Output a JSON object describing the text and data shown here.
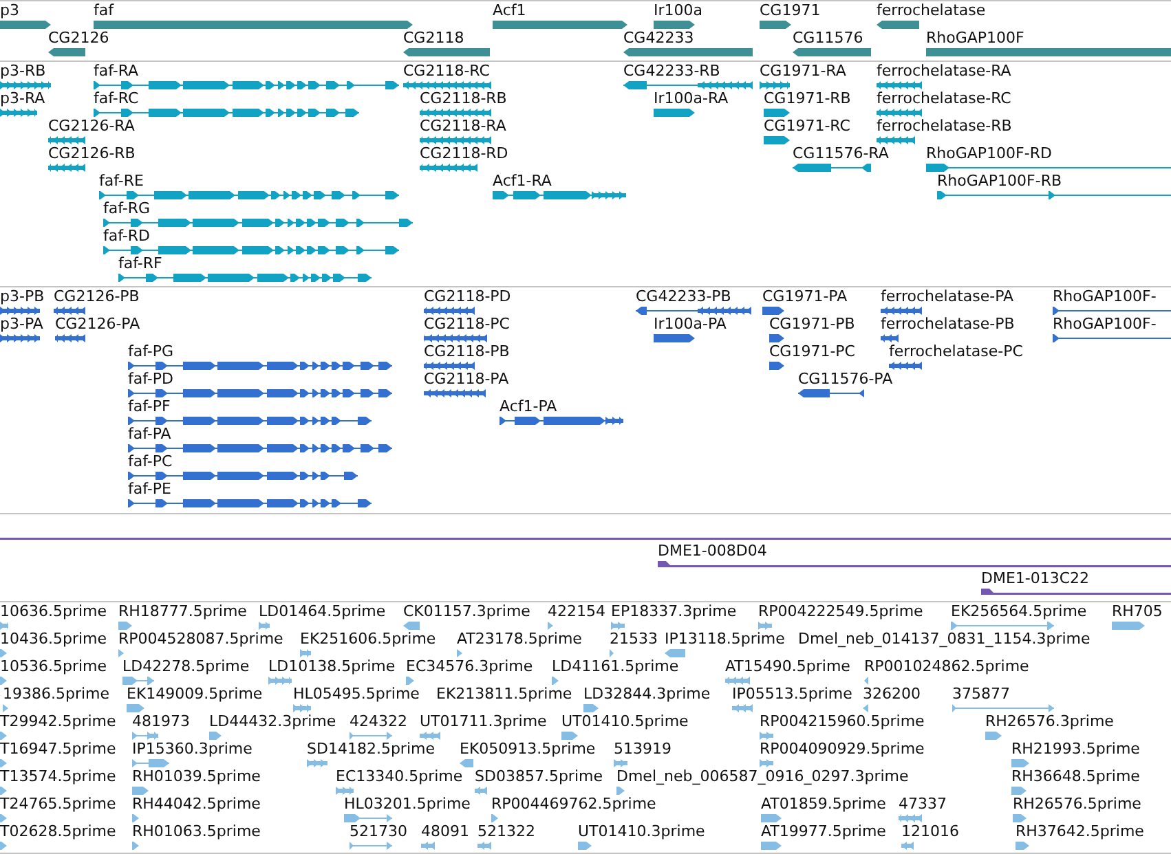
{
  "tracks": [
    {
      "kind": "gene",
      "rows": [
        {
          "features": [
            {
              "label": "p3",
              "reverse": false
            },
            {
              "label": "faf",
              "reverse": false
            },
            {
              "label": "Acf1",
              "reverse": false
            },
            {
              "label": "Ir100a",
              "reverse": false
            },
            {
              "label": "CG1971",
              "reverse": false
            },
            {
              "label": "ferrochelatase",
              "reverse": true
            }
          ]
        },
        {
          "features": [
            {
              "label": "CG2126",
              "reverse": true
            },
            {
              "label": "CG2118",
              "reverse": true
            },
            {
              "label": "CG42233",
              "reverse": true
            },
            {
              "label": "CG11576",
              "reverse": true
            },
            {
              "label": "RhoGAP100F",
              "reverse": false
            }
          ]
        }
      ]
    },
    {
      "kind": "mrna",
      "rows": [
        {
          "features": [
            {
              "label": "p3-RB",
              "reverse": false
            },
            {
              "label": "faf-RA",
              "reverse": false
            },
            {
              "label": "CG2118-RC",
              "reverse": true
            },
            {
              "label": "CG42233-RB",
              "reverse": true
            },
            {
              "label": "CG1971-RA",
              "reverse": false
            },
            {
              "label": "ferrochelatase-RA",
              "reverse": true
            }
          ]
        },
        {
          "features": [
            {
              "label": "p3-RA",
              "reverse": false
            },
            {
              "label": "faf-RC",
              "reverse": false
            },
            {
              "label": "CG2118-RB",
              "reverse": true
            },
            {
              "label": "Ir100a-RA",
              "reverse": false
            },
            {
              "label": "CG1971-RB",
              "reverse": false
            },
            {
              "label": "ferrochelatase-RC",
              "reverse": true
            }
          ]
        },
        {
          "features": [
            {
              "label": "CG2126-RA",
              "reverse": true
            },
            {
              "label": "CG2118-RA",
              "reverse": true
            },
            {
              "label": "CG1971-RC",
              "reverse": false
            },
            {
              "label": "ferrochelatase-RB",
              "reverse": true
            }
          ]
        },
        {
          "features": [
            {
              "label": "CG2126-RB",
              "reverse": true
            },
            {
              "label": "CG2118-RD",
              "reverse": true
            },
            {
              "label": "CG11576-RA",
              "reverse": true
            },
            {
              "label": "RhoGAP100F-RD",
              "reverse": false
            }
          ]
        },
        {
          "features": [
            {
              "label": "faf-RE",
              "reverse": false
            },
            {
              "label": "Acf1-RA",
              "reverse": false
            },
            {
              "label": "RhoGAP100F-RB",
              "reverse": false
            }
          ]
        },
        {
          "features": [
            {
              "label": "faf-RG",
              "reverse": false
            }
          ]
        },
        {
          "features": [
            {
              "label": "faf-RD",
              "reverse": false
            }
          ]
        },
        {
          "features": [
            {
              "label": "faf-RF",
              "reverse": false
            }
          ]
        }
      ]
    },
    {
      "kind": "protein",
      "rows": [
        {
          "features": [
            {
              "label": "p3-PB",
              "reverse": false
            },
            {
              "label": "CG2126-PB",
              "reverse": true
            },
            {
              "label": "CG2118-PD",
              "reverse": true
            },
            {
              "label": "CG42233-PB",
              "reverse": true
            },
            {
              "label": "CG1971-PA",
              "reverse": false
            },
            {
              "label": "ferrochelatase-PA",
              "reverse": true
            },
            {
              "label": "RhoGAP100F-",
              "reverse": false
            }
          ]
        },
        {
          "features": [
            {
              "label": "p3-PA",
              "reverse": false
            },
            {
              "label": "CG2126-PA",
              "reverse": true
            },
            {
              "label": "CG2118-PC",
              "reverse": true
            },
            {
              "label": "Ir100a-PA",
              "reverse": false
            },
            {
              "label": "CG1971-PB",
              "reverse": false
            },
            {
              "label": "ferrochelatase-PB",
              "reverse": true
            },
            {
              "label": "RhoGAP100F-",
              "reverse": false
            }
          ]
        },
        {
          "features": [
            {
              "label": "faf-PG",
              "reverse": false
            },
            {
              "label": "CG2118-PB",
              "reverse": true
            },
            {
              "label": "CG1971-PC",
              "reverse": false
            },
            {
              "label": "ferrochelatase-PC",
              "reverse": true
            }
          ]
        },
        {
          "features": [
            {
              "label": "faf-PD",
              "reverse": false
            },
            {
              "label": "CG2118-PA",
              "reverse": true
            },
            {
              "label": "CG11576-PA",
              "reverse": true
            }
          ]
        },
        {
          "features": [
            {
              "label": "faf-PF",
              "reverse": false
            },
            {
              "label": "Acf1-PA",
              "reverse": false
            }
          ]
        },
        {
          "features": [
            {
              "label": "faf-PA",
              "reverse": false
            }
          ]
        },
        {
          "features": [
            {
              "label": "faf-PC",
              "reverse": false
            }
          ]
        },
        {
          "features": [
            {
              "label": "faf-PE",
              "reverse": false
            }
          ]
        }
      ]
    },
    {
      "kind": "clone",
      "rows": [
        {
          "features": [
            {
              "label": "DME1-008D04",
              "reverse": false
            }
          ]
        },
        {
          "features": [
            {
              "label": "DME1-013C22",
              "reverse": false
            }
          ]
        }
      ]
    },
    {
      "kind": "est",
      "rows": [
        {
          "features": [
            {
              "label": "10636.5prime",
              "reverse": false
            },
            {
              "label": "RH18777.5prime",
              "reverse": false
            },
            {
              "label": "LD01464.5prime",
              "reverse": false
            },
            {
              "label": "CK01157.3prime",
              "reverse": true
            },
            {
              "label": "422154",
              "reverse": false
            },
            {
              "label": "EP18337.3prime",
              "reverse": false
            },
            {
              "label": "RP004222549.5prime",
              "reverse": false
            },
            {
              "label": "EK256564.5prime",
              "reverse": false
            },
            {
              "label": "RH705",
              "reverse": false
            }
          ]
        },
        {
          "features": [
            {
              "label": "10436.5prime",
              "reverse": false
            },
            {
              "label": "RP004528087.5prime",
              "reverse": false
            },
            {
              "label": "EK251606.5prime",
              "reverse": false
            },
            {
              "label": "AT23178.5prime",
              "reverse": false
            },
            {
              "label": "21533",
              "reverse": false
            },
            {
              "label": "IP13118.5prime",
              "reverse": true
            },
            {
              "label": "Dmel_neb_014137_0831_1154.3prime"
            }
          ]
        },
        {
          "features": [
            {
              "label": "10536.5prime",
              "reverse": false
            },
            {
              "label": "LD42278.5prime",
              "reverse": false
            },
            {
              "label": "LD10138.5prime",
              "reverse": false
            },
            {
              "label": "EC34576.3prime",
              "reverse": false
            },
            {
              "label": "LD41161.5prime",
              "reverse": false
            },
            {
              "label": "AT15490.5prime",
              "reverse": true
            },
            {
              "label": "RP001024862.5prime",
              "reverse": true
            }
          ]
        },
        {
          "features": [
            {
              "label": "19386.5prime",
              "reverse": false
            },
            {
              "label": "EK149009.5prime",
              "reverse": false
            },
            {
              "label": "HL05495.5prime",
              "reverse": false
            },
            {
              "label": "EK213811.5prime"
            },
            {
              "label": "LD32844.3prime",
              "reverse": false
            },
            {
              "label": "IP05513.5prime",
              "reverse": true
            },
            {
              "label": "326200",
              "reverse": true
            },
            {
              "label": "375877",
              "reverse": false
            }
          ]
        },
        {
          "features": [
            {
              "label": "T29942.5prime",
              "reverse": false
            },
            {
              "label": "481973",
              "reverse": false
            },
            {
              "label": "LD44432.3prime",
              "reverse": false
            },
            {
              "label": "424322",
              "reverse": false
            },
            {
              "label": "UT01711.3prime",
              "reverse": true
            },
            {
              "label": "UT01410.5prime",
              "reverse": false
            },
            {
              "label": "RP004215960.5prime",
              "reverse": false
            },
            {
              "label": "RH26576.3prime",
              "reverse": false
            }
          ]
        },
        {
          "features": [
            {
              "label": "T16947.5prime",
              "reverse": false
            },
            {
              "label": "IP15360.3prime",
              "reverse": false
            },
            {
              "label": "SD14182.5prime",
              "reverse": false
            },
            {
              "label": "EK050913.5prime",
              "reverse": true
            },
            {
              "label": "513919",
              "reverse": false
            },
            {
              "label": "RP004090929.5prime",
              "reverse": false
            },
            {
              "label": "RH21993.5prime",
              "reverse": false
            }
          ]
        },
        {
          "features": [
            {
              "label": "T13574.5prime",
              "reverse": false
            },
            {
              "label": "RH01039.5prime",
              "reverse": false
            },
            {
              "label": "EC13340.5prime",
              "reverse": false
            },
            {
              "label": "SD03857.5prime",
              "reverse": true
            },
            {
              "label": "Dmel_neb_006587_0916_0297.3prime",
              "reverse": false
            },
            {
              "label": "RH36648.5prime",
              "reverse": false
            }
          ]
        },
        {
          "features": [
            {
              "label": "T24765.5prime",
              "reverse": false
            },
            {
              "label": "RH44042.5prime",
              "reverse": false
            },
            {
              "label": "HL03201.5prime",
              "reverse": false
            },
            {
              "label": "RP004469762.5prime",
              "reverse": false
            },
            {
              "label": "AT01859.5prime",
              "reverse": false
            },
            {
              "label": "47337",
              "reverse": true
            },
            {
              "label": "RH26576.5prime",
              "reverse": false
            }
          ]
        },
        {
          "features": [
            {
              "label": "T02628.5prime",
              "reverse": false
            },
            {
              "label": "RH01063.5prime",
              "reverse": false
            },
            {
              "label": "521730",
              "reverse": false
            },
            {
              "label": "48091",
              "reverse": true
            },
            {
              "label": "521322",
              "reverse": true
            },
            {
              "label": "UT01410.3prime",
              "reverse": false
            },
            {
              "label": "AT19977.5prime",
              "reverse": false
            },
            {
              "label": "121016",
              "reverse": true
            },
            {
              "label": "RH37642.5prime",
              "reverse": false
            }
          ]
        }
      ]
    }
  ]
}
